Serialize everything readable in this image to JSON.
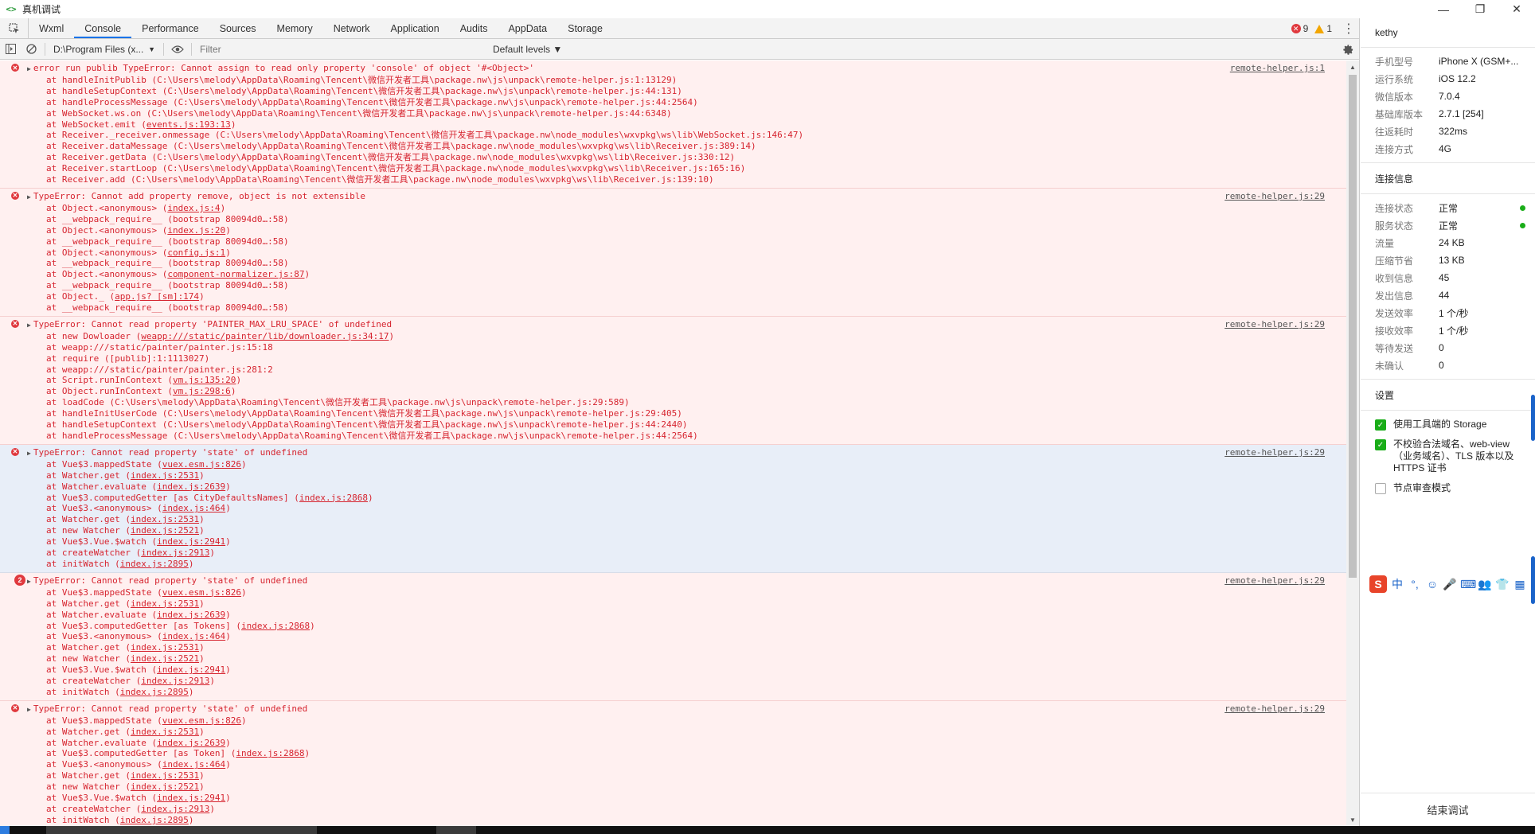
{
  "window": {
    "app_icon": "<>",
    "title": "真机调试",
    "controls": [
      "—",
      "❐",
      "✕"
    ]
  },
  "tabs": [
    "Wxml",
    "Console",
    "Performance",
    "Sources",
    "Memory",
    "Network",
    "Application",
    "Audits",
    "AppData",
    "Storage"
  ],
  "active_tab": "Console",
  "badges": {
    "errors": "9",
    "warnings": "1"
  },
  "toolbar": {
    "context": "D:\\Program Files (x...",
    "filter_placeholder": "Filter",
    "levels": "Default levels ▼"
  },
  "messages": [
    {
      "head": "error run publib TypeError: Cannot assign to read only property 'console' of object '#<Object>'",
      "src": "remote-helper.js:1",
      "selected": false,
      "frames": [
        "at handleInitPublib (C:\\Users\\melody\\AppData\\Roaming\\Tencent\\微信开发者工具\\package.nw\\js\\unpack\\remote-helper.js:1:13129)",
        "at handleSetupContext (C:\\Users\\melody\\AppData\\Roaming\\Tencent\\微信开发者工具\\package.nw\\js\\unpack\\remote-helper.js:44:131)",
        "at handleProcessMessage (C:\\Users\\melody\\AppData\\Roaming\\Tencent\\微信开发者工具\\package.nw\\js\\unpack\\remote-helper.js:44:2564)",
        "at WebSocket.ws.on (C:\\Users\\melody\\AppData\\Roaming\\Tencent\\微信开发者工具\\package.nw\\js\\unpack\\remote-helper.js:44:6348)",
        "at WebSocket.emit (events.js:193:13)",
        "at Receiver._receiver.onmessage (C:\\Users\\melody\\AppData\\Roaming\\Tencent\\微信开发者工具\\package.nw\\node_modules\\wxvpkg\\ws\\lib\\WebSocket.js:146:47)",
        "at Receiver.dataMessage (C:\\Users\\melody\\AppData\\Roaming\\Tencent\\微信开发者工具\\package.nw\\node_modules\\wxvpkg\\ws\\lib\\Receiver.js:389:14)",
        "at Receiver.getData (C:\\Users\\melody\\AppData\\Roaming\\Tencent\\微信开发者工具\\package.nw\\node_modules\\wxvpkg\\ws\\lib\\Receiver.js:330:12)",
        "at Receiver.startLoop (C:\\Users\\melody\\AppData\\Roaming\\Tencent\\微信开发者工具\\package.nw\\node_modules\\wxvpkg\\ws\\lib\\Receiver.js:165:16)",
        "at Receiver.add (C:\\Users\\melody\\AppData\\Roaming\\Tencent\\微信开发者工具\\package.nw\\node_modules\\wxvpkg\\ws\\lib\\Receiver.js:139:10)"
      ]
    },
    {
      "head": "TypeError: Cannot add property remove, object is not extensible",
      "src": "remote-helper.js:29",
      "selected": false,
      "frames": [
        "at Object.<anonymous> (index.js:4)",
        "at __webpack_require__ (bootstrap 80094d0…:58)",
        "at Object.<anonymous> (index.js:20)",
        "at __webpack_require__ (bootstrap 80094d0…:58)",
        "at Object.<anonymous> (config.js:1)",
        "at __webpack_require__ (bootstrap 80094d0…:58)",
        "at Object.<anonymous> (component-normalizer.js:87)",
        "at __webpack_require__ (bootstrap 80094d0…:58)",
        "at Object._ (app.js? [sm]:174)",
        "at __webpack_require__ (bootstrap 80094d0…:58)"
      ]
    },
    {
      "head": "TypeError: Cannot read property 'PAINTER_MAX_LRU_SPACE' of undefined",
      "src": "remote-helper.js:29",
      "selected": false,
      "frames": [
        "at new Dowloader (weapp:///static/painter/lib/downloader.js:34:17)",
        "at weapp:///static/painter/painter.js:15:18",
        "at require ([publib]:1:1113027)",
        "at weapp:///static/painter/painter.js:281:2",
        "at Script.runInContext (vm.js:135:20)",
        "at Object.runInContext (vm.js:298:6)",
        "at loadCode (C:\\Users\\melody\\AppData\\Roaming\\Tencent\\微信开发者工具\\package.nw\\js\\unpack\\remote-helper.js:29:589)",
        "at handleInitUserCode (C:\\Users\\melody\\AppData\\Roaming\\Tencent\\微信开发者工具\\package.nw\\js\\unpack\\remote-helper.js:29:405)",
        "at handleSetupContext (C:\\Users\\melody\\AppData\\Roaming\\Tencent\\微信开发者工具\\package.nw\\js\\unpack\\remote-helper.js:44:2440)",
        "at handleProcessMessage (C:\\Users\\melody\\AppData\\Roaming\\Tencent\\微信开发者工具\\package.nw\\js\\unpack\\remote-helper.js:44:2564)"
      ]
    },
    {
      "head": "TypeError: Cannot read property 'state' of undefined",
      "src": "remote-helper.js:29",
      "selected": true,
      "frames": [
        "at Vue$3.mappedState (vuex.esm.js:826)",
        "at Watcher.get (index.js:2531)",
        "at Watcher.evaluate (index.js:2639)",
        "at Vue$3.computedGetter [as CityDefaultsNames] (index.js:2868)",
        "at Vue$3.<anonymous> (index.js:464)",
        "at Watcher.get (index.js:2531)",
        "at new Watcher (index.js:2521)",
        "at Vue$3.Vue.$watch (index.js:2941)",
        "at createWatcher (index.js:2913)",
        "at initWatch (index.js:2895)"
      ]
    },
    {
      "head": "TypeError: Cannot read property 'state' of undefined",
      "src": "remote-helper.js:29",
      "selected": false,
      "count": "2",
      "frames": [
        "at Vue$3.mappedState (vuex.esm.js:826)",
        "at Watcher.get (index.js:2531)",
        "at Watcher.evaluate (index.js:2639)",
        "at Vue$3.computedGetter [as Tokens] (index.js:2868)",
        "at Vue$3.<anonymous> (index.js:464)",
        "at Watcher.get (index.js:2531)",
        "at new Watcher (index.js:2521)",
        "at Vue$3.Vue.$watch (index.js:2941)",
        "at createWatcher (index.js:2913)",
        "at initWatch (index.js:2895)"
      ]
    },
    {
      "head": "TypeError: Cannot read property 'state' of undefined",
      "src": "remote-helper.js:29",
      "selected": false,
      "frames": [
        "at Vue$3.mappedState (vuex.esm.js:826)",
        "at Watcher.get (index.js:2531)",
        "at Watcher.evaluate (index.js:2639)",
        "at Vue$3.computedGetter [as Token] (index.js:2868)",
        "at Vue$3.<anonymous> (index.js:464)",
        "at Watcher.get (index.js:2531)",
        "at new Watcher (index.js:2521)",
        "at Vue$3.Vue.$watch (index.js:2941)",
        "at createWatcher (index.js:2913)",
        "at initWatch (index.js:2895)"
      ]
    }
  ],
  "device": {
    "user": "kethy",
    "rows": [
      {
        "k": "手机型号",
        "v": "iPhone X (GSM+..."
      },
      {
        "k": "运行系统",
        "v": "iOS 12.2"
      },
      {
        "k": "微信版本",
        "v": "7.0.4"
      },
      {
        "k": "基础库版本",
        "v": "2.7.1 [254]"
      },
      {
        "k": "往返耗时",
        "v": "322ms"
      },
      {
        "k": "连接方式",
        "v": "4G"
      }
    ]
  },
  "connection": {
    "title": "连接信息",
    "rows": [
      {
        "k": "连接状态",
        "v": "正常",
        "dot": true
      },
      {
        "k": "服务状态",
        "v": "正常",
        "dot": true
      },
      {
        "k": "流量",
        "v": "24 KB"
      },
      {
        "k": "压缩节省",
        "v": "13 KB"
      },
      {
        "k": "收到信息",
        "v": "45"
      },
      {
        "k": "发出信息",
        "v": "44"
      },
      {
        "k": "发送效率",
        "v": "1 个/秒"
      },
      {
        "k": "接收效率",
        "v": "1 个/秒"
      },
      {
        "k": "等待发送",
        "v": "0"
      },
      {
        "k": "未确认",
        "v": "0"
      }
    ]
  },
  "settings": {
    "title": "设置",
    "options": [
      {
        "label": "使用工具端的 Storage",
        "checked": true
      },
      {
        "label": "不校验合法域名、web-view（业务域名）、TLS 版本以及 HTTPS 证书",
        "checked": true
      },
      {
        "label": "节点审查模式",
        "checked": false
      }
    ]
  },
  "ime": [
    "中",
    "°,",
    "☺",
    "🎤",
    "⌨",
    "👥",
    "👕",
    "▦"
  ],
  "end_debug": "结束调试",
  "colors": {
    "error": "#d6242f",
    "error_bg": "#fff0f0",
    "accent": "#1a73e8",
    "ok": "#1aad19"
  }
}
